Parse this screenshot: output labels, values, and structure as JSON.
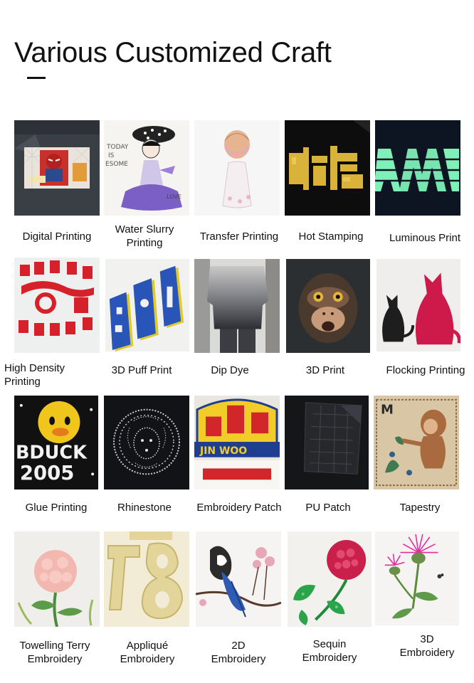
{
  "page": {
    "title": "Various Customized Craft"
  },
  "crafts": [
    {
      "label": "Digital Printing",
      "icon": "digital-printing-tshirt"
    },
    {
      "label": "Water Slurry\nPrinting",
      "icon": "water-slurry-girl-print"
    },
    {
      "label": "Transfer Printing",
      "icon": "transfer-printing-figure"
    },
    {
      "label": "Hot Stamping",
      "icon": "hot-stamping-gold-letters"
    },
    {
      "label": "Luminous Print",
      "icon": "luminous-print-glow-letters"
    },
    {
      "label": "High Density\nPrinting",
      "icon": "high-density-red-letters"
    },
    {
      "label": "3D Puff Print",
      "icon": "puff-print-blue-letters"
    },
    {
      "label": "Dip Dye",
      "icon": "dip-dye-gradient-tee"
    },
    {
      "label": "3D Print",
      "icon": "monkey-face-print"
    },
    {
      "label": "Flocking Printing",
      "icon": "flocking-cats"
    },
    {
      "label": "Glue Printing",
      "icon": "glue-print-duck"
    },
    {
      "label": "Rhinestone",
      "icon": "rhinestone-medallion"
    },
    {
      "label": "Embroidery Patch",
      "icon": "embroidery-patch"
    },
    {
      "label": "PU Patch",
      "icon": "pu-leather-patch"
    },
    {
      "label": "Tapestry",
      "icon": "tapestry-monkey"
    },
    {
      "label": "Towelling Terry\nEmbroidery",
      "icon": "terry-flower"
    },
    {
      "label": "Appliqué\nEmbroidery",
      "icon": "applique-numbers"
    },
    {
      "label": "2D\nEmbroidery",
      "icon": "bird-branch-embroidery"
    },
    {
      "label": "Sequin\nEmbroidery",
      "icon": "sequin-rose"
    },
    {
      "label": "3D\nEmbroidery",
      "icon": "thistle-embroidery"
    }
  ]
}
